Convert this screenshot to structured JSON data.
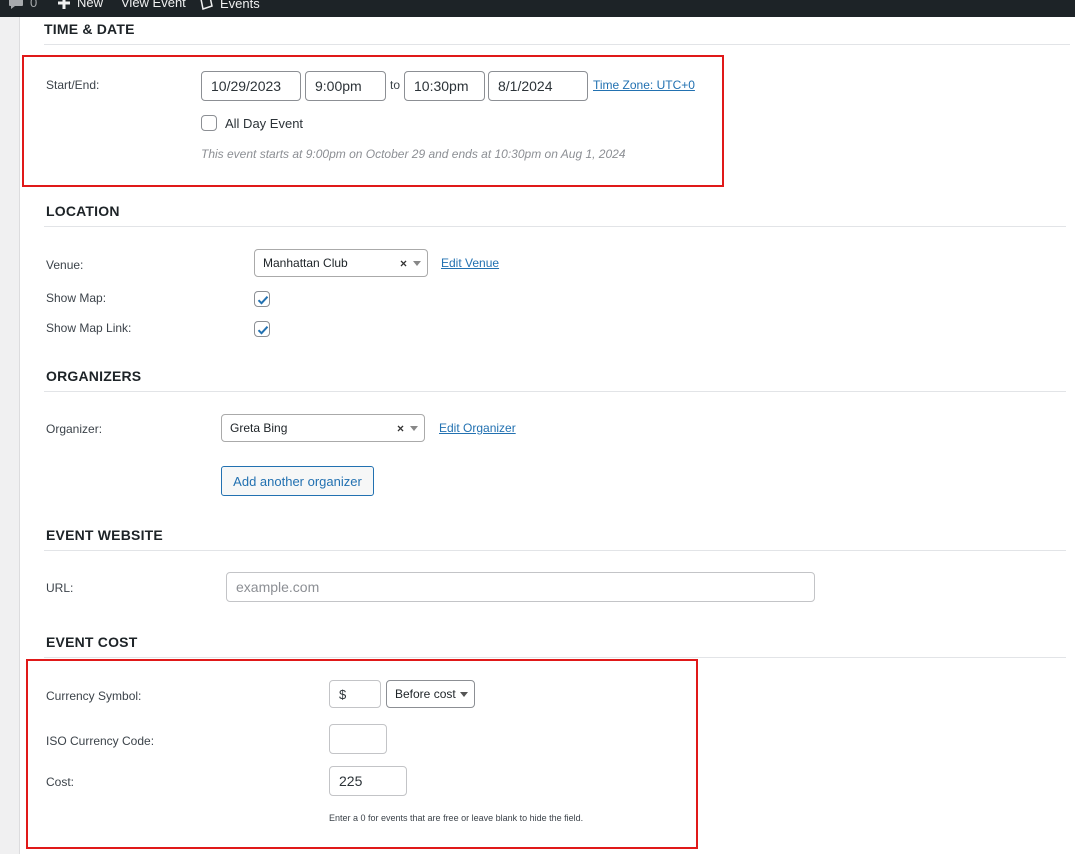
{
  "adminbar": {
    "comment_count": "0",
    "new_label": "New",
    "view_event_label": "View Event",
    "events_label": "Events"
  },
  "time_date": {
    "title": "TIME & DATE",
    "start_end_label": "Start/End:",
    "start_date": "10/29/2023",
    "start_time": "9:00pm",
    "to_label": "to",
    "end_time": "10:30pm",
    "end_date": "8/1/2024",
    "timezone_link": "Time Zone: UTC+0",
    "all_day_label": "All Day Event",
    "all_day_checked": false,
    "summary": "This event starts at 9:00pm on October 29 and ends at 10:30pm on Aug 1, 2024"
  },
  "location": {
    "title": "LOCATION",
    "venue_label": "Venue:",
    "venue_value": "Manhattan Club",
    "edit_venue_link": "Edit Venue",
    "show_map_label": "Show Map:",
    "show_map_checked": true,
    "show_map_link_label": "Show Map Link:",
    "show_map_link_checked": true
  },
  "organizers": {
    "title": "ORGANIZERS",
    "organizer_label": "Organizer:",
    "organizer_value": "Greta Bing",
    "edit_organizer_link": "Edit Organizer",
    "add_button": "Add another organizer"
  },
  "website": {
    "title": "EVENT WEBSITE",
    "url_label": "URL:",
    "url_placeholder": "example.com"
  },
  "cost": {
    "title": "EVENT COST",
    "currency_symbol_label": "Currency Symbol:",
    "currency_symbol_value": "$",
    "position_value": "Before cost",
    "iso_label": "ISO Currency Code:",
    "iso_value": "",
    "cost_label": "Cost:",
    "cost_value": "225",
    "help": "Enter a 0 for events that are free or leave blank to hide the field."
  },
  "colors": {
    "accent": "#2271b1",
    "highlight_box": "#e01919",
    "adminbar": "#1d2327"
  }
}
